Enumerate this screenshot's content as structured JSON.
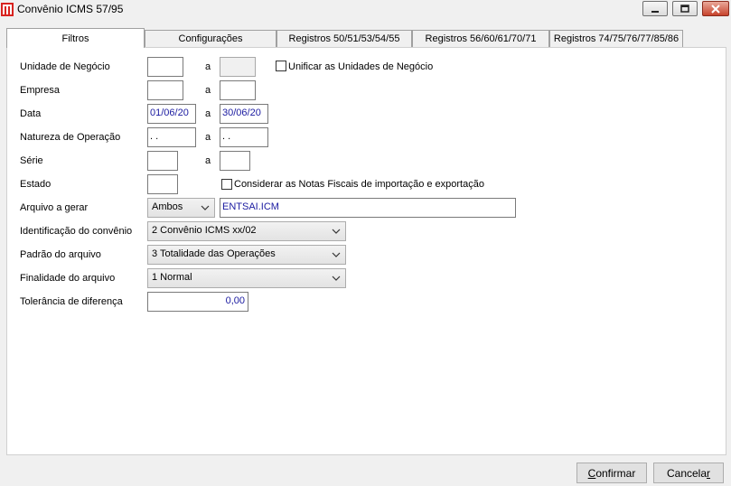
{
  "window": {
    "title": "Convênio ICMS 57/95"
  },
  "tabs": [
    {
      "label": "Filtros",
      "active": true
    },
    {
      "label": "Configurações",
      "active": false
    },
    {
      "label": "Registros 50/51/53/54/55",
      "active": false
    },
    {
      "label": "Registros 56/60/61/70/71",
      "active": false
    },
    {
      "label": "Registros 74/75/76/77/85/86",
      "active": false
    }
  ],
  "form": {
    "range_sep": "a",
    "unidade": {
      "label": "Unidade de Negócio",
      "from": "",
      "to": "",
      "unify_label": "Unificar as Unidades de Negócio",
      "unify_checked": false
    },
    "empresa": {
      "label": "Empresa",
      "from": "",
      "to": ""
    },
    "data": {
      "label": "Data",
      "from": "01/06/20",
      "to": "30/06/20"
    },
    "natureza": {
      "label": "Natureza de Operação",
      "from": " .  .",
      "to": " .  ."
    },
    "serie": {
      "label": "Série",
      "from": "",
      "to": ""
    },
    "estado": {
      "label": "Estado",
      "value": "",
      "notas_label": "Considerar as Notas Fiscais de importação e exportação",
      "notas_checked": false
    },
    "arquivo": {
      "label": "Arquivo a gerar",
      "option": "Ambos",
      "filename": "ENTSAI.ICM"
    },
    "identificacao": {
      "label": "Identificação do convênio",
      "option": "2 Convênio ICMS xx/02"
    },
    "padrao": {
      "label": "Padrão do arquivo",
      "option": "3 Totalidade das Operações"
    },
    "finalidade": {
      "label": "Finalidade do arquivo",
      "option": "1 Normal"
    },
    "tolerancia": {
      "label": "Tolerância de diferença",
      "value": "0,00"
    }
  },
  "buttons": {
    "confirm_first": "C",
    "confirm_rest": "onfirmar",
    "cancel_first": "Cancela",
    "cancel_underlined": "r"
  },
  "icons": {
    "app": "app-logo-icon",
    "minimize": "minimize-icon",
    "maximize": "maximize-icon",
    "close": "close-icon",
    "dropdown": "chevron-down-icon"
  },
  "colors": {
    "accent_text": "#1a1aa0",
    "close_button": "#c7432c"
  }
}
